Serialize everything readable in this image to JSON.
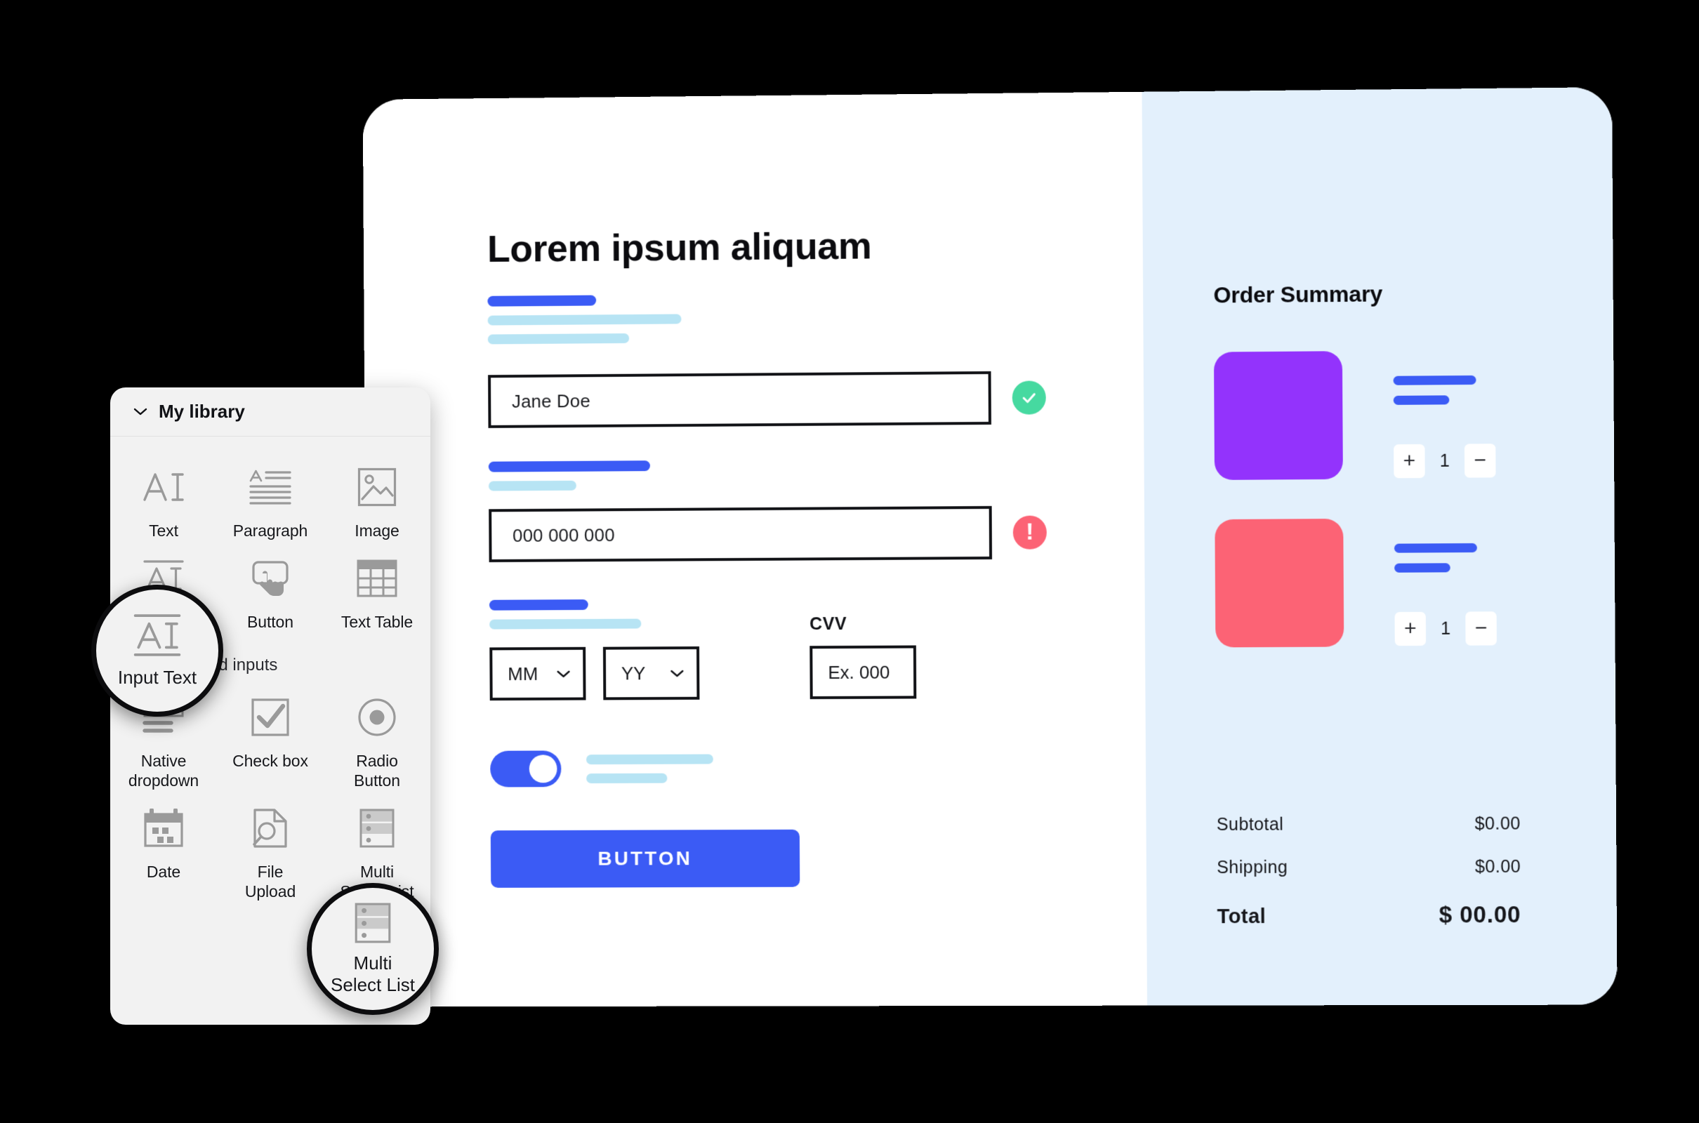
{
  "checkout": {
    "title": "Lorem ipsum aliquam",
    "name_field": {
      "value": "Jane Doe",
      "status": "valid"
    },
    "card_field": {
      "value": "000 000 000",
      "status": "error"
    },
    "expiry": {
      "month": "MM",
      "year": "YY"
    },
    "cvv": {
      "label": "CVV",
      "placeholder": "Ex. 000"
    },
    "submit_label": "BUTTON"
  },
  "summary": {
    "title": "Order Summary",
    "items": [
      {
        "color": "#9333FC",
        "qty": "1",
        "decrement": "−",
        "increment": "+"
      },
      {
        "color": "#FC6375",
        "qty": "1",
        "decrement": "−",
        "increment": "+"
      }
    ],
    "totals": [
      {
        "label": "Subtotal",
        "value": "$0.00"
      },
      {
        "label": "Shipping",
        "value": "$0.00"
      }
    ],
    "grand_total": {
      "label": "Total",
      "value": "$ 00.00"
    }
  },
  "library": {
    "header": "My library",
    "sections": [
      {
        "name": "",
        "items": [
          {
            "label": "Text",
            "icon": "text-icon"
          },
          {
            "label": "Paragraph",
            "icon": "paragraph-icon"
          },
          {
            "label": "Image",
            "icon": "image-icon"
          },
          {
            "label": "Input Text",
            "icon": "input-text-icon"
          },
          {
            "label": "Button",
            "icon": "button-icon"
          },
          {
            "label": "Text Table",
            "icon": "text-table-icon"
          }
        ]
      },
      {
        "name": "Forms and inputs",
        "items": [
          {
            "label": "Native\ndropdown",
            "icon": "native-dropdown-icon"
          },
          {
            "label": "Check box",
            "icon": "check-box-icon"
          },
          {
            "label": "Radio\nButton",
            "icon": "radio-button-icon"
          },
          {
            "label": "Date",
            "icon": "date-icon"
          },
          {
            "label": "File\nUpload",
            "icon": "file-upload-icon"
          },
          {
            "label": "Multi\nSelect List",
            "icon": "multi-select-list-icon"
          }
        ]
      }
    ]
  },
  "magnifiers": [
    {
      "label": "Input Text",
      "icon": "input-text-icon"
    },
    {
      "label": "Multi\nSelect List",
      "icon": "multi-select-list-icon"
    }
  ],
  "colors": {
    "accent_blue": "#3B5BF5",
    "light_blue_bar": "#B7E4F4",
    "panel_bg": "#E3F0FC",
    "success_green": "#46D9A0",
    "error_red": "#FC6375",
    "thumb_purple": "#9333FC",
    "thumb_red": "#FC6375",
    "canvas_black": "#000000"
  }
}
